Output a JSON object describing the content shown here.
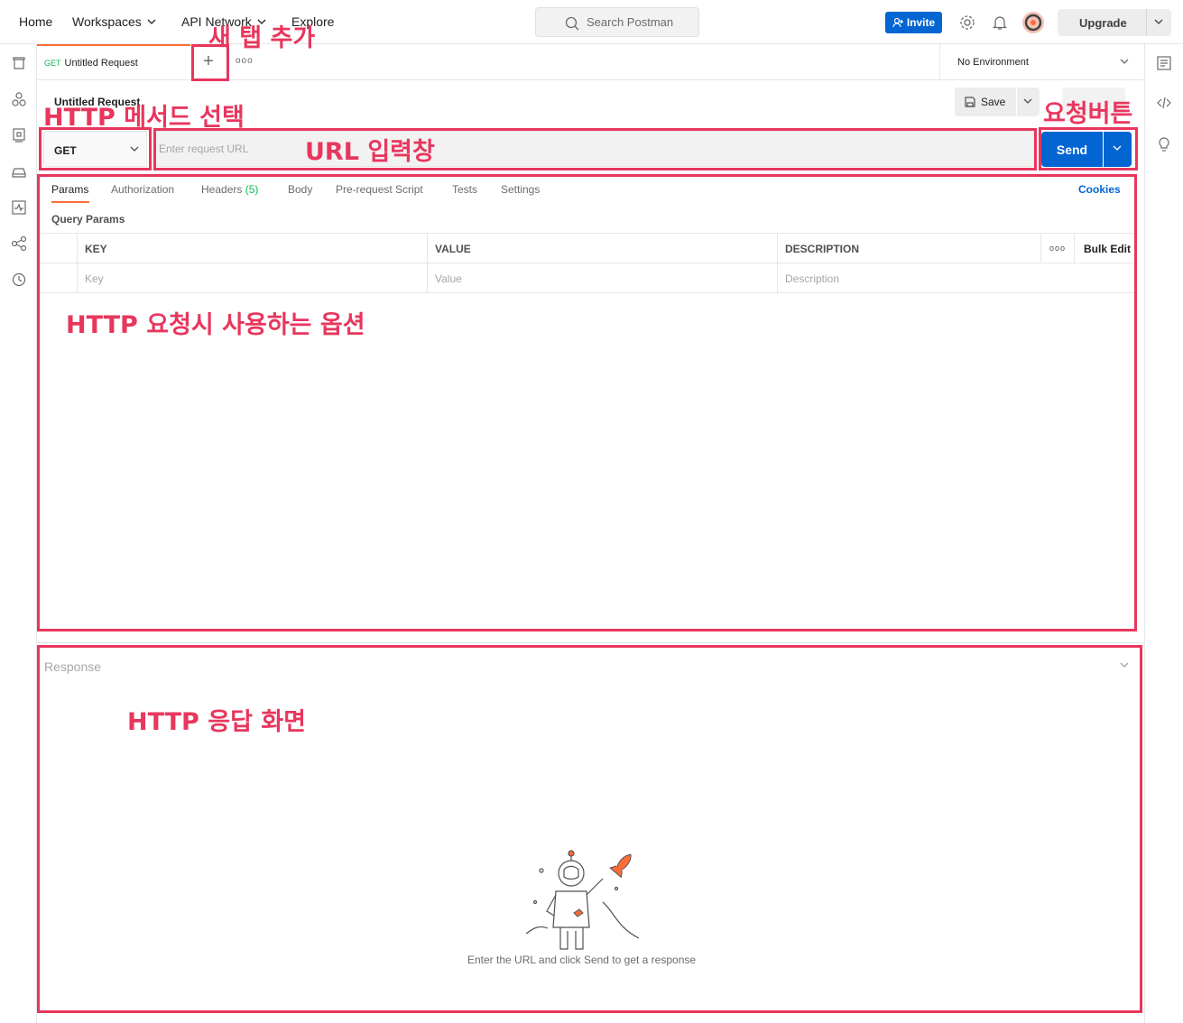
{
  "topbar": {
    "nav": [
      "Home",
      "Workspaces",
      "API Network",
      "Explore"
    ],
    "search_placeholder": "Search Postman",
    "invite_label": "Invite",
    "upgrade_label": "Upgrade"
  },
  "tabs": {
    "active": {
      "method": "GET",
      "name": "Untitled Request"
    },
    "environment": "No Environment"
  },
  "request": {
    "title": "Untitled Request",
    "save_label": "Save",
    "method": "GET",
    "url_placeholder": "Enter request URL",
    "send_label": "Send"
  },
  "options": {
    "tabs": [
      "Params",
      "Authorization",
      "Headers",
      "Body",
      "Pre-request Script",
      "Tests",
      "Settings"
    ],
    "headers_count": "(5)",
    "cookies": "Cookies",
    "query_title": "Query Params",
    "columns": [
      "KEY",
      "VALUE",
      "DESCRIPTION"
    ],
    "bulk_edit": "Bulk Edit",
    "placeholders": [
      "Key",
      "Value",
      "Description"
    ]
  },
  "response": {
    "label": "Response",
    "hint": "Enter the URL and click Send to get a response"
  },
  "annotations": {
    "new_tab": "새 탭 추가",
    "method": "HTTP 메서드 선택",
    "url": "URL 입력창",
    "send": "요청버튼",
    "options": "HTTP 요청시 사용하는 옵션",
    "response": "HTTP 응답 화면"
  },
  "colors": {
    "accent": "#ff6c37",
    "primary": "#0265d2",
    "annotation": "#e8365d"
  }
}
